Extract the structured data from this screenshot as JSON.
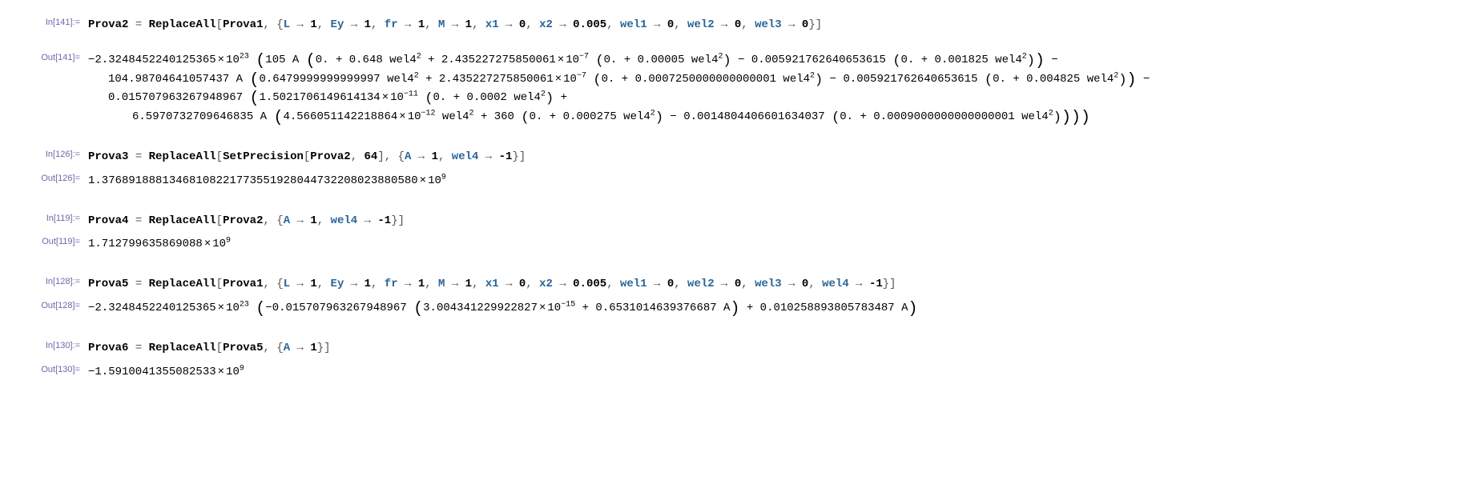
{
  "cells": {
    "c141in_label": "In[141]:=",
    "c141in_code": {
      "lhs": "Prova2",
      "fn": "ReplaceAll",
      "arg0": "Prova1",
      "rules": [
        [
          "L",
          "1"
        ],
        [
          "Ey",
          "1"
        ],
        [
          "fr",
          "1"
        ],
        [
          "M",
          "1"
        ],
        [
          "x1",
          "0"
        ],
        [
          "x2",
          "0.005"
        ],
        [
          "wel1",
          "0"
        ],
        [
          "wel2",
          "0"
        ],
        [
          "wel3",
          "0"
        ]
      ]
    },
    "c141out_label": "Out[141]=",
    "c141out_math": {
      "prefix": "−2.3248452240125365",
      "prefix_exp": "23",
      "line1_a": "105 A ",
      "line1_b": "0. + 0.648 wel4",
      "line1_c": " + 2.435227275850061",
      "line1_c_exp": "−7",
      "line1_d": "0. + 0.00005 wel4",
      "line1_e": " − 0.005921762640653615 ",
      "line1_f": "0. + 0.001825 wel4",
      "line1_tail": " −",
      "line2_a": "104.98704641057437 A ",
      "line2_b": "0.6479999999999997 wel4",
      "line2_c": " + 2.435227275850061",
      "line2_c_exp": "−7",
      "line2_d": "0. + 0.0007250000000000001 wel4",
      "line2_e": " − 0.005921762640653615 ",
      "line2_f": "0. + 0.004825 wel4",
      "line2_tail": " −",
      "line3_a": "0.015707963267948967 ",
      "line3_b": "1.5021706149614134",
      "line3_b_exp": "−11",
      "line3_c": "0. + 0.0002 wel4",
      "line3_tail": " +",
      "line4_a": "6.5970732709646835 A ",
      "line4_b": "4.566051142218864",
      "line4_b_exp": "−12",
      "line4_c": " wel4",
      "line4_d": " + 360 ",
      "line4_e": "0. + 0.000275 wel4",
      "line4_f": " − 0.0014804406601634037 ",
      "line4_g": "0. + 0.0009000000000000001 wel4"
    },
    "c126in_label": "In[126]:=",
    "c126in_code": {
      "lhs": "Prova3",
      "fn": "ReplaceAll",
      "inner_fn": "SetPrecision",
      "inner_arg0": "Prova2",
      "inner_arg1": "64",
      "rules": [
        [
          "A",
          "1"
        ],
        [
          "wel4",
          "-1"
        ]
      ]
    },
    "c126out_label": "Out[126]=",
    "c126out_mantissa": "1.376891888134681082217735519280447322080238805 80",
    "c126out_note_true": "1.37689188813468108221773551928044732208023880580",
    "c126out_exp": "9",
    "c119in_label": "In[119]:=",
    "c119in_code": {
      "lhs": "Prova4",
      "fn": "ReplaceAll",
      "arg0": "Prova2",
      "rules": [
        [
          "A",
          "1"
        ],
        [
          "wel4",
          "-1"
        ]
      ]
    },
    "c119out_label": "Out[119]=",
    "c119out_mantissa": "1.712799635869088",
    "c119out_exp": "9",
    "c128in_label": "In[128]:=",
    "c128in_code": {
      "lhs": "Prova5",
      "fn": "ReplaceAll",
      "arg0": "Prova1",
      "rules": [
        [
          "L",
          "1"
        ],
        [
          "Ey",
          "1"
        ],
        [
          "fr",
          "1"
        ],
        [
          "M",
          "1"
        ],
        [
          "x1",
          "0"
        ],
        [
          "x2",
          "0.005"
        ],
        [
          "wel1",
          "0"
        ],
        [
          "wel2",
          "0"
        ],
        [
          "wel3",
          "0"
        ],
        [
          "wel4",
          "-1"
        ]
      ]
    },
    "c128out_label": "Out[128]=",
    "c128out": {
      "prefix": "−2.3248452240125365",
      "prefix_exp": "23",
      "a": "−0.015707963267948967 ",
      "b": "3.004341229922827",
      "b_exp": "−15",
      "c": " + 0.6531014639376687 A",
      "d": " + 0.010258893805783487 A"
    },
    "c130in_label": "In[130]:=",
    "c130in_code": {
      "lhs": "Prova6",
      "fn": "ReplaceAll",
      "arg0": "Prova5",
      "rules": [
        [
          "A",
          "1"
        ]
      ]
    },
    "c130out_label": "Out[130]=",
    "c130out_mantissa": "−1.5910041355082533",
    "c130out_exp": "9"
  }
}
